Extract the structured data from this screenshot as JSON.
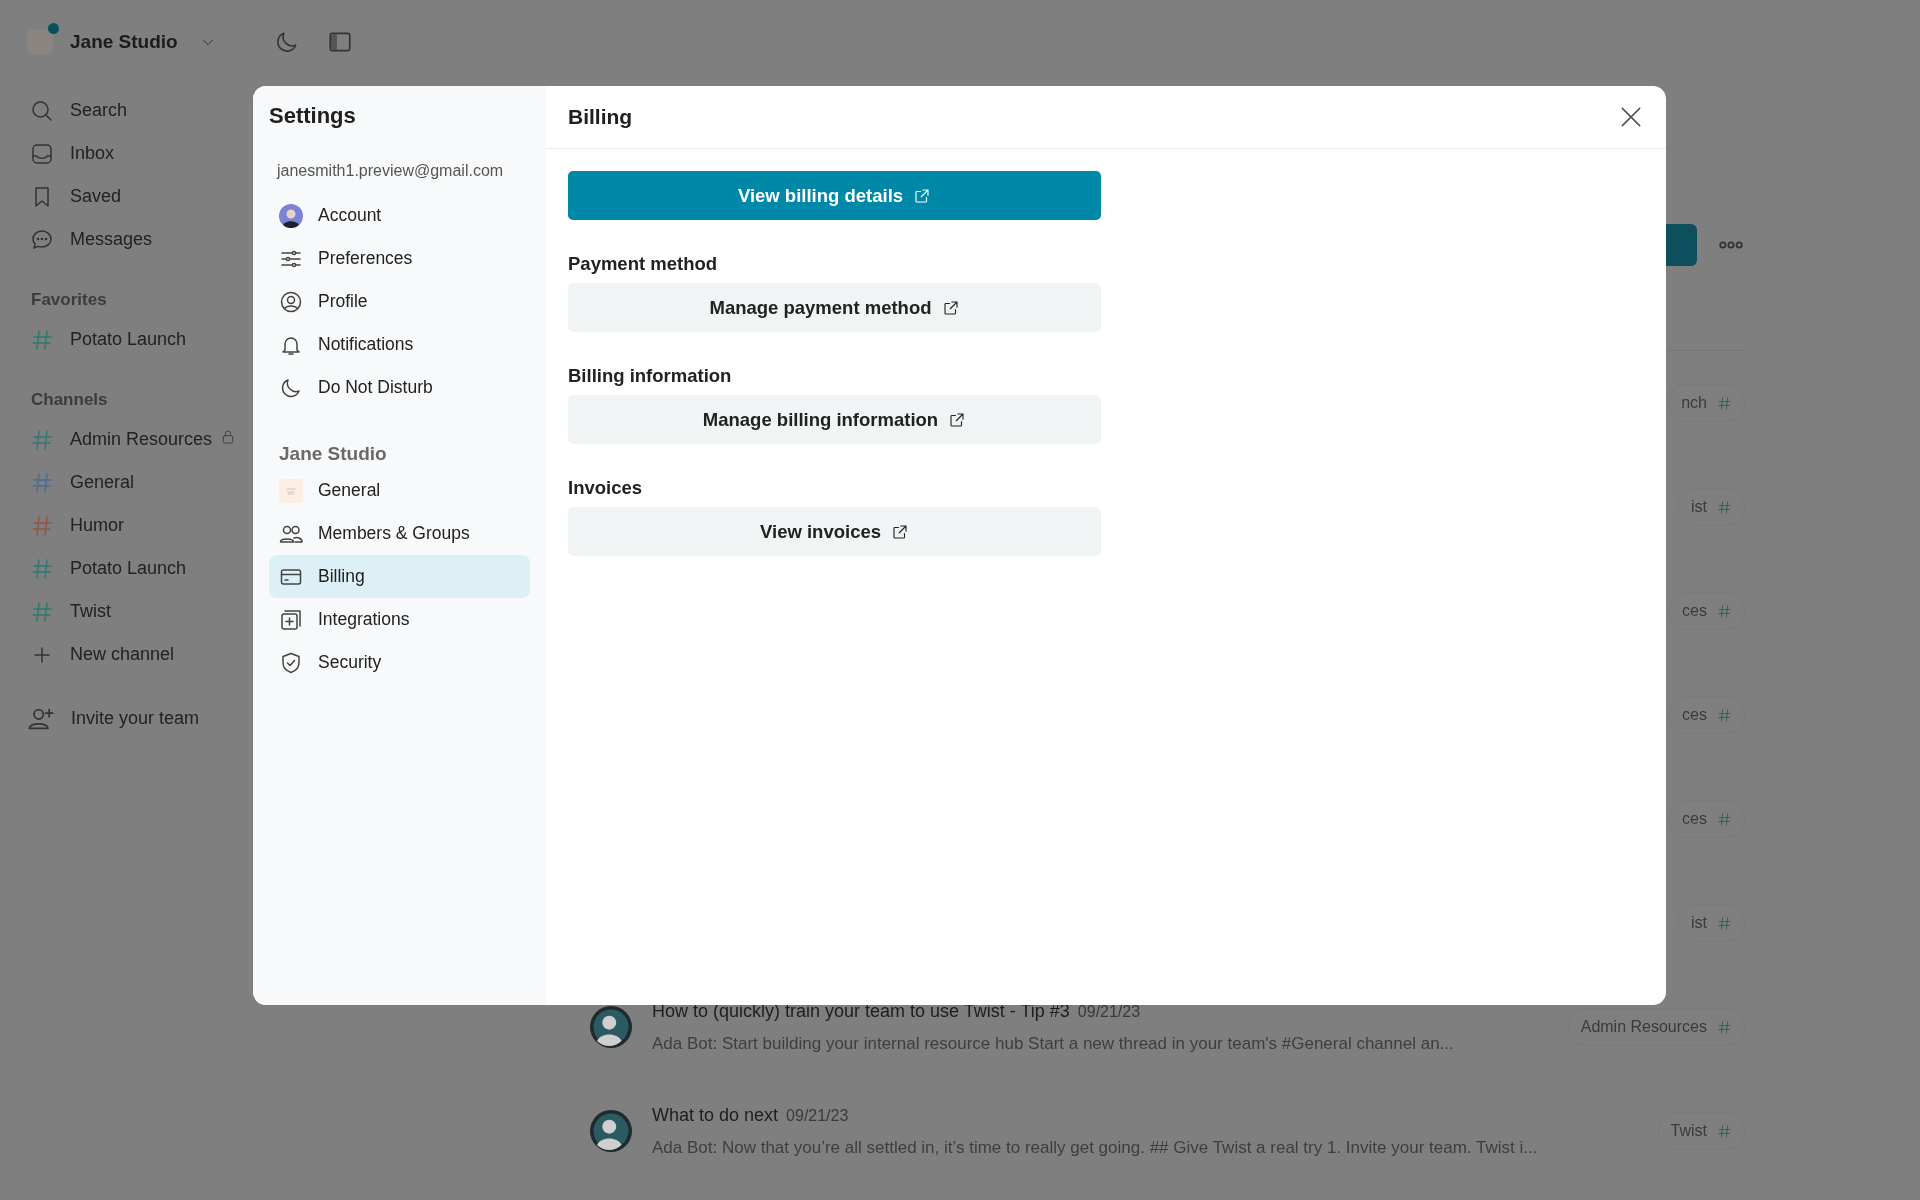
{
  "workspace": {
    "name": "Jane Studio",
    "notification": true
  },
  "sidebar": {
    "nav": [
      {
        "label": "Search",
        "kind": "search"
      },
      {
        "label": "Inbox",
        "kind": "inbox"
      },
      {
        "label": "Saved",
        "kind": "bookmark"
      },
      {
        "label": "Messages",
        "kind": "chat"
      }
    ],
    "sections": [
      {
        "title": "Favorites",
        "channels": [
          {
            "name": "Potato Launch",
            "color": "#2e7a72",
            "locked": false
          }
        ]
      },
      {
        "title": "Channels",
        "channels": [
          {
            "name": "Admin Resources",
            "color": "#2e7a72",
            "locked": true
          },
          {
            "name": "General",
            "color": "#4a6d92",
            "locked": false
          },
          {
            "name": "Humor",
            "color": "#94553f",
            "locked": false
          },
          {
            "name": "Potato Launch",
            "color": "#2e7a72",
            "locked": false
          },
          {
            "name": "Twist",
            "color": "#2e7a72",
            "locked": false
          }
        ]
      }
    ],
    "new_channel": "New channel",
    "invite": "Invite your team"
  },
  "threads": [
    {
      "tag": "nch"
    },
    {
      "tag": "ist"
    },
    {
      "tag": "ces"
    },
    {
      "tag": "ces"
    },
    {
      "tag": "ces"
    },
    {
      "tag": "ist"
    },
    {
      "title": "How to (quickly) train your team to use Twist - Tip #3",
      "date": "09/21/23",
      "preview": "Ada Bot: Start building your internal resource hub Start a new thread in your team's #General channel an...",
      "tag": "Admin Resources"
    },
    {
      "title": "What to do next",
      "date": "09/21/23",
      "preview": "Ada Bot: Now that you’re all settled in, it’s time to really get going. ## Give Twist a real try 1. Invite your team. Twist i...",
      "tag": "Twist"
    }
  ],
  "settings": {
    "title": "Settings",
    "email": "janesmith1.preview@gmail.com",
    "personal": [
      {
        "label": "Account",
        "kind": "avatar",
        "selected": false
      },
      {
        "label": "Preferences",
        "kind": "sliders",
        "selected": false
      },
      {
        "label": "Profile",
        "kind": "user",
        "selected": false
      },
      {
        "label": "Notifications",
        "kind": "bell",
        "selected": false
      },
      {
        "label": "Do Not Disturb",
        "kind": "moon",
        "selected": false
      }
    ],
    "workspace_heading": "Jane Studio",
    "workspace_items": [
      {
        "label": "General",
        "kind": "logo",
        "selected": false
      },
      {
        "label": "Members & Groups",
        "kind": "people",
        "selected": false
      },
      {
        "label": "Billing",
        "kind": "card",
        "selected": true
      },
      {
        "label": "Integrations",
        "kind": "plus-square",
        "selected": false
      },
      {
        "label": "Security",
        "kind": "shield",
        "selected": false
      }
    ],
    "page": {
      "title": "Billing",
      "primary": "View billing details",
      "sections": [
        {
          "heading": "Payment method",
          "button": "Manage payment method"
        },
        {
          "heading": "Billing information",
          "button": "Manage billing information"
        },
        {
          "heading": "Invoices",
          "button": "View invoices"
        }
      ]
    }
  }
}
